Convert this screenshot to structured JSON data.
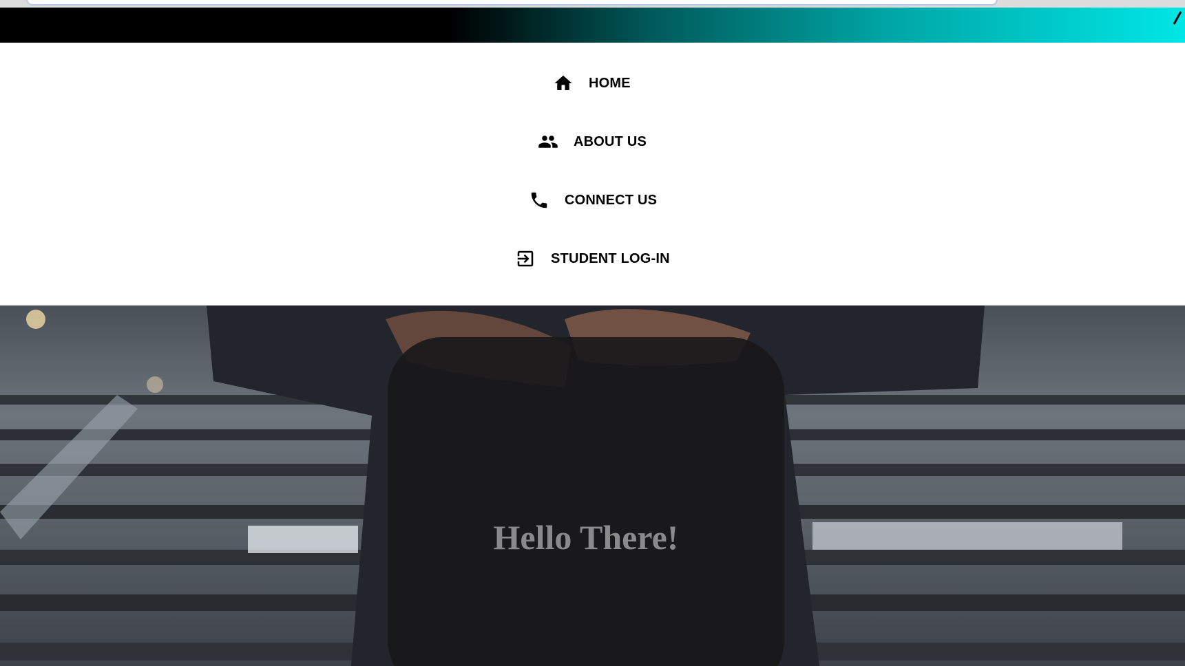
{
  "nav": {
    "items": [
      {
        "label": "HOME",
        "icon": "home-icon"
      },
      {
        "label": "ABOUT US",
        "icon": "people-icon"
      },
      {
        "label": "CONNECT US",
        "icon": "phone-icon"
      },
      {
        "label": "STUDENT LOG-IN",
        "icon": "login-icon"
      }
    ]
  },
  "hero": {
    "greeting": "Hello There!"
  },
  "colors": {
    "top_bar_gradient": [
      "#000000",
      "#005a5a",
      "#00a6a6",
      "#00e6e6"
    ],
    "nav_text": "#000000",
    "card_background": "#19191b",
    "greeting_text": "#8a8a8a"
  }
}
